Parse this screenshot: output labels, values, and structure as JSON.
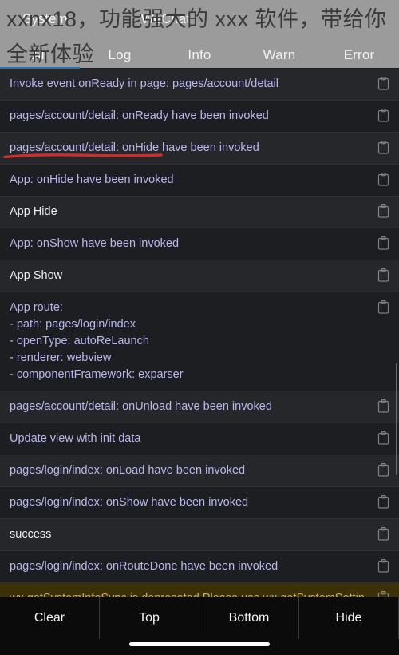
{
  "overlay": {
    "promo_text": "xxnx18，功能强大的 xxx 软件，带给你全新体验"
  },
  "header": {
    "top_tabs": [
      {
        "label": "System",
        "active": false
      },
      {
        "label": "WeChat",
        "active": false
      }
    ],
    "filter_tabs": [
      {
        "label": "All",
        "active": true
      },
      {
        "label": "Log",
        "active": false
      },
      {
        "label": "Info",
        "active": false
      },
      {
        "label": "Warn",
        "active": false
      },
      {
        "label": "Error",
        "active": false
      }
    ],
    "active_indicator_color": "#2f6fb0"
  },
  "colors": {
    "header_bg": "#9b9b9b",
    "log_link": "#b9b6ec",
    "log_plain": "#efefef",
    "warn_text": "#d0a95a",
    "warn_bg": "#3a3108",
    "annotation_red": "#c8312b"
  },
  "log": {
    "copy_icon": "clipboard-icon",
    "rows": [
      {
        "text": "Invoke event onReady in page: pages/account/detail",
        "style": "link",
        "shade": "odd"
      },
      {
        "text": "pages/account/detail: onReady have been invoked",
        "style": "link",
        "shade": "even"
      },
      {
        "text": "pages/account/detail: onHide have been invoked",
        "style": "link",
        "shade": "odd"
      },
      {
        "text": "App: onHide have been invoked",
        "style": "link",
        "shade": "even"
      },
      {
        "text": "App Hide",
        "style": "plain",
        "shade": "odd"
      },
      {
        "text": "App: onShow have been invoked",
        "style": "link",
        "shade": "even"
      },
      {
        "text": "App Show",
        "style": "plain",
        "shade": "odd"
      },
      {
        "text": "App route:\n- path: pages/login/index\n- openType: autoReLaunch\n- renderer: webview\n- componentFramework: exparser",
        "style": "link",
        "shade": "even"
      },
      {
        "text": "pages/account/detail: onUnload have been invoked",
        "style": "link",
        "shade": "odd"
      },
      {
        "text": "Update view with init data",
        "style": "link",
        "shade": "even"
      },
      {
        "text": "pages/login/index: onLoad have been invoked",
        "style": "link",
        "shade": "odd"
      },
      {
        "text": "pages/login/index: onShow have been invoked",
        "style": "link",
        "shade": "even"
      },
      {
        "text": "success",
        "style": "plain",
        "shade": "odd"
      },
      {
        "text": "pages/login/index: onRouteDone have been invoked",
        "style": "link",
        "shade": "even"
      },
      {
        "text": "wx.getSystemInfoSync is deprecated.Please use wx.getSystemSetting/wx.getAppAuthorizeSetting/wx.getDeviceInfo/wx.getWindowInfo/wx.getAppBaseInfo instead.",
        "style": "warn",
        "shade": "warn"
      }
    ]
  },
  "toolbar": {
    "buttons": [
      {
        "label": "Clear"
      },
      {
        "label": "Top"
      },
      {
        "label": "Bottom"
      },
      {
        "label": "Hide"
      }
    ]
  }
}
